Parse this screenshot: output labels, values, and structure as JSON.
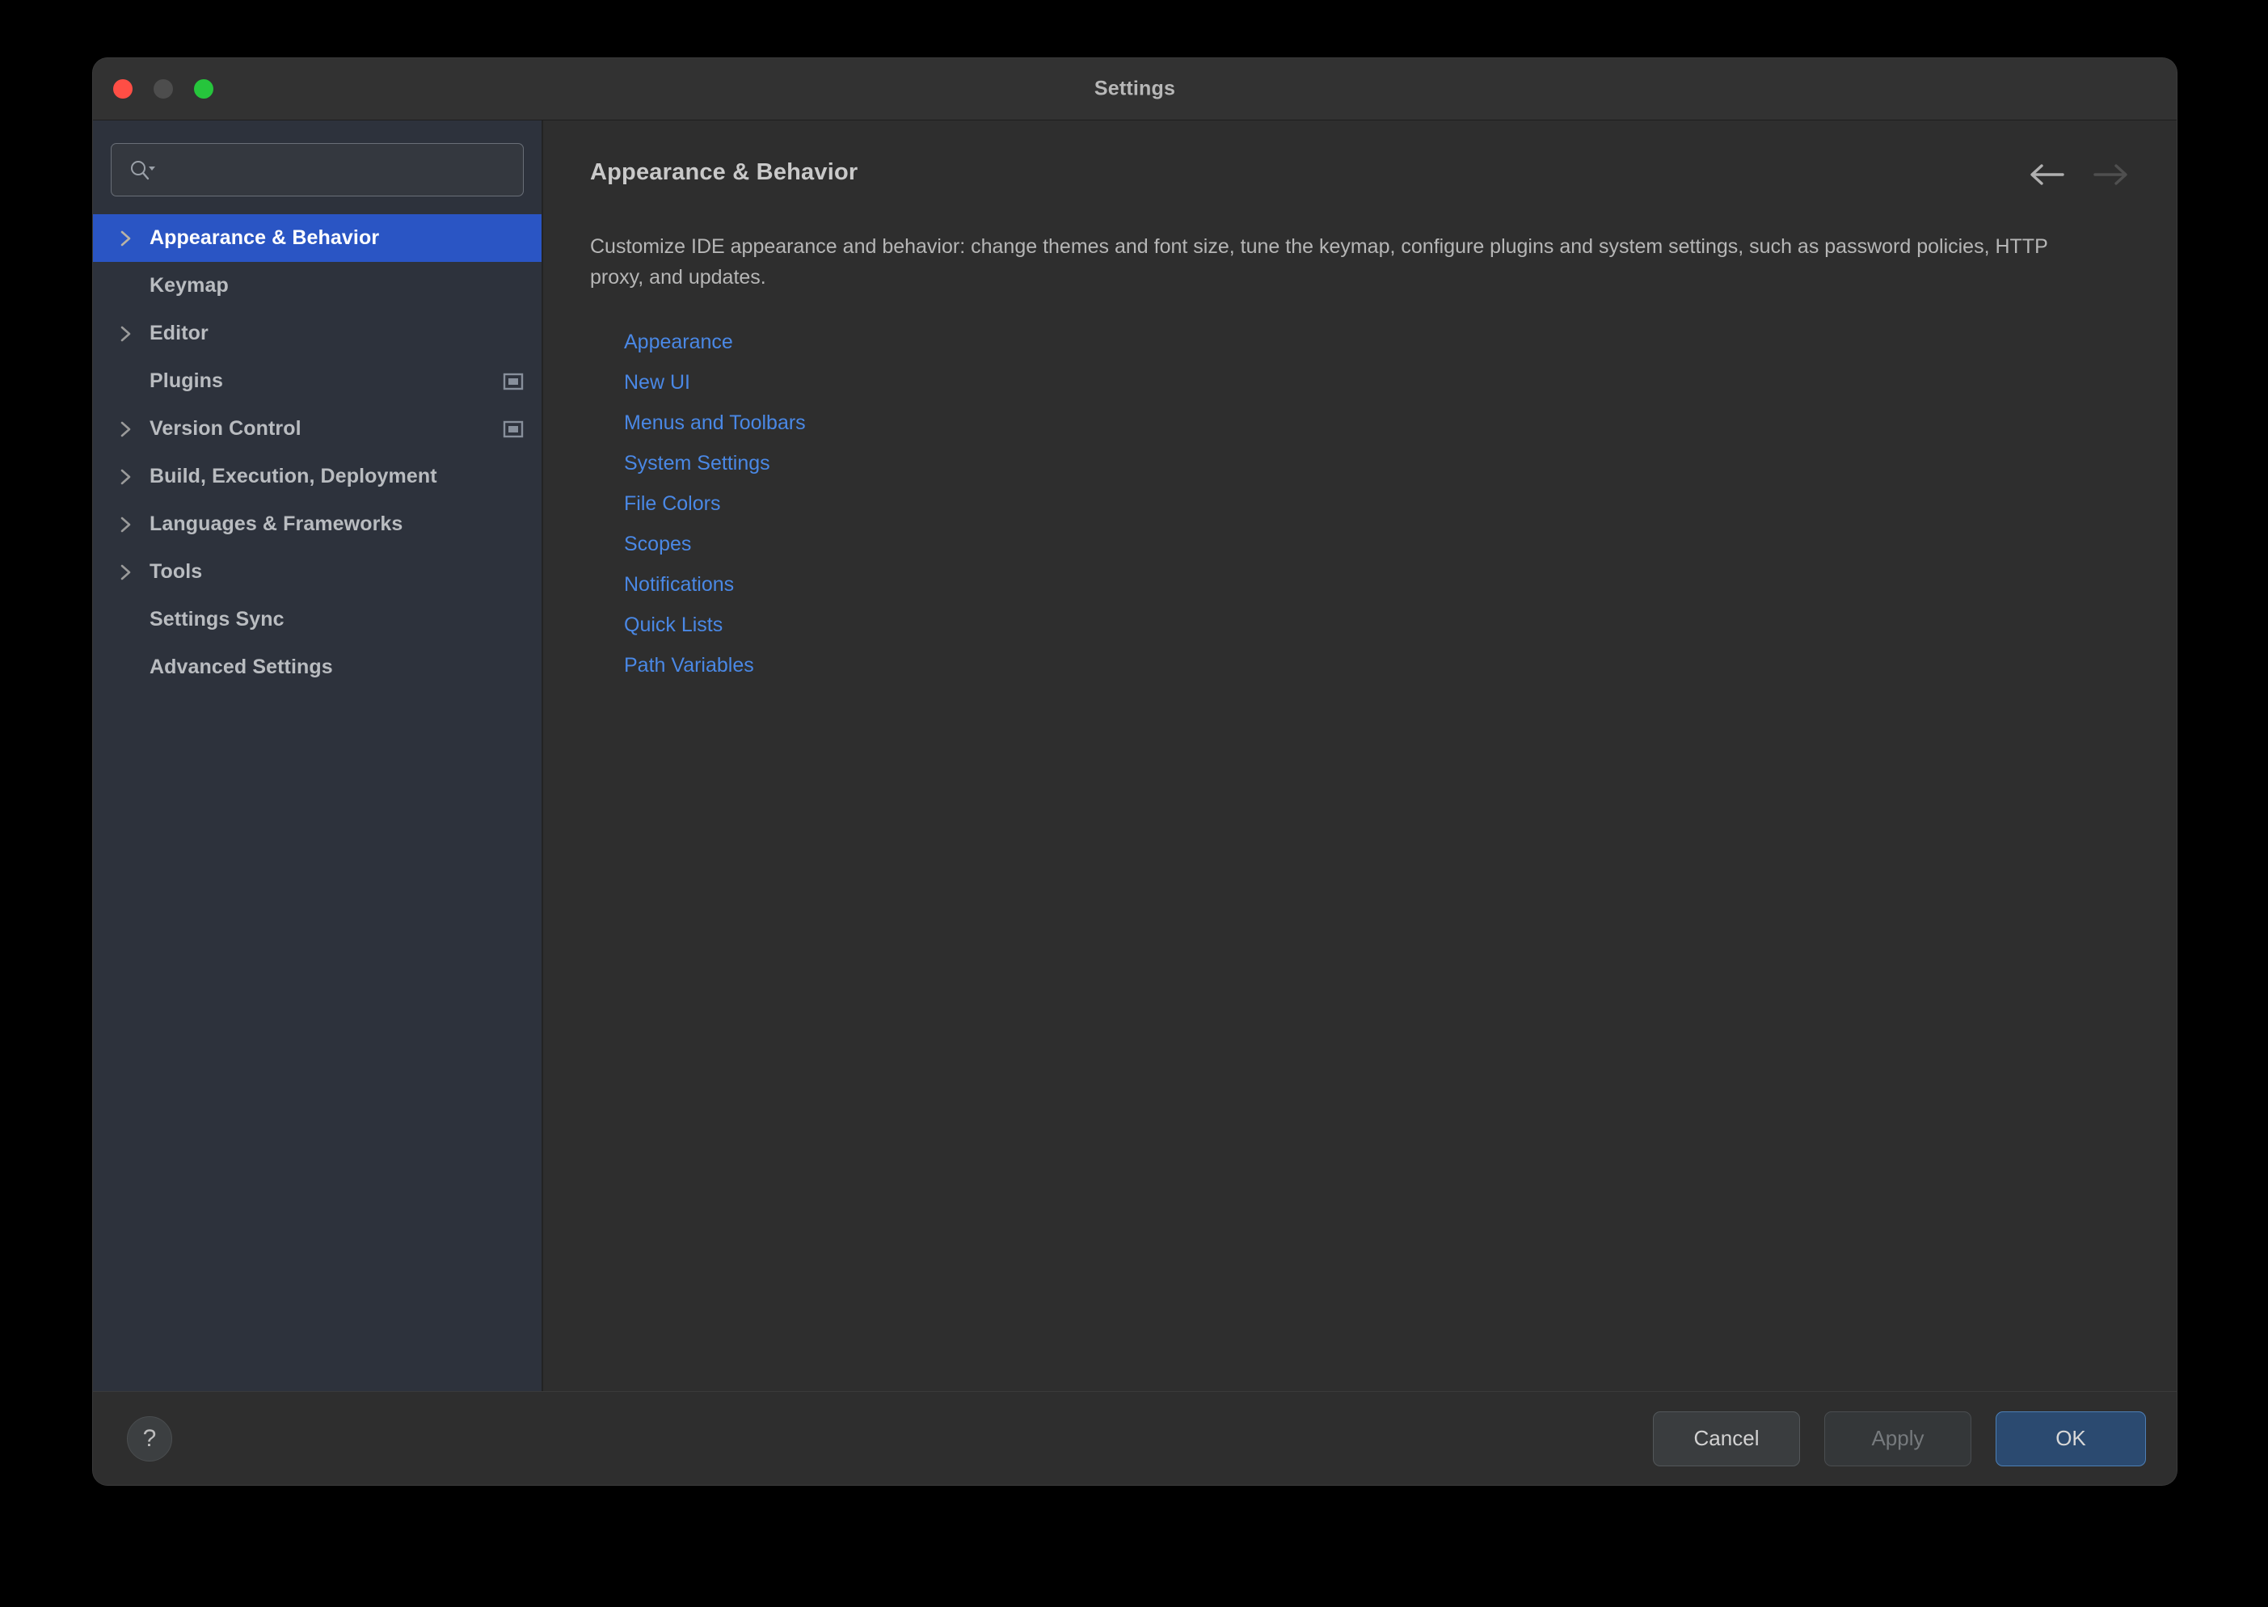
{
  "window": {
    "title": "Settings",
    "traffic_lights": [
      "close-button",
      "minimize-button",
      "zoom-button"
    ]
  },
  "sidebar": {
    "search": {
      "value": "",
      "placeholder": "",
      "icon": "search-icon-with-dropdown"
    },
    "items": [
      {
        "label": "Appearance & Behavior",
        "expandable": true,
        "selected": true,
        "badge": false
      },
      {
        "label": "Keymap",
        "expandable": false,
        "selected": false,
        "badge": false
      },
      {
        "label": "Editor",
        "expandable": true,
        "selected": false,
        "badge": false
      },
      {
        "label": "Plugins",
        "expandable": false,
        "selected": false,
        "badge": true
      },
      {
        "label": "Version Control",
        "expandable": true,
        "selected": false,
        "badge": true
      },
      {
        "label": "Build, Execution, Deployment",
        "expandable": true,
        "selected": false,
        "badge": false
      },
      {
        "label": "Languages & Frameworks",
        "expandable": true,
        "selected": false,
        "badge": false
      },
      {
        "label": "Tools",
        "expandable": true,
        "selected": false,
        "badge": false
      },
      {
        "label": "Settings Sync",
        "expandable": false,
        "selected": false,
        "badge": false
      },
      {
        "label": "Advanced Settings",
        "expandable": false,
        "selected": false,
        "badge": false
      }
    ]
  },
  "content": {
    "title": "Appearance & Behavior",
    "description": "Customize IDE appearance and behavior: change themes and font size, tune the keymap, configure plugins and system settings, such as password policies, HTTP proxy, and updates.",
    "nav": {
      "back_icon": "arrow-left-icon",
      "forward_icon": "arrow-right-icon",
      "back_enabled": true,
      "forward_enabled": false
    },
    "links": [
      "Appearance",
      "New UI",
      "Menus and Toolbars",
      "System Settings",
      "File Colors",
      "Scopes",
      "Notifications",
      "Quick Lists",
      "Path Variables"
    ]
  },
  "footer": {
    "help_label": "?",
    "cancel_label": "Cancel",
    "apply_label": "Apply",
    "apply_enabled": false,
    "ok_label": "OK"
  },
  "colors": {
    "selection_blue": "#2a55c4",
    "link_blue": "#4a88e5",
    "ok_button": "#2b4a70",
    "sidebar_bg": "#2d323c",
    "content_bg": "#2e2e2e",
    "titlebar_bg": "#323232"
  }
}
